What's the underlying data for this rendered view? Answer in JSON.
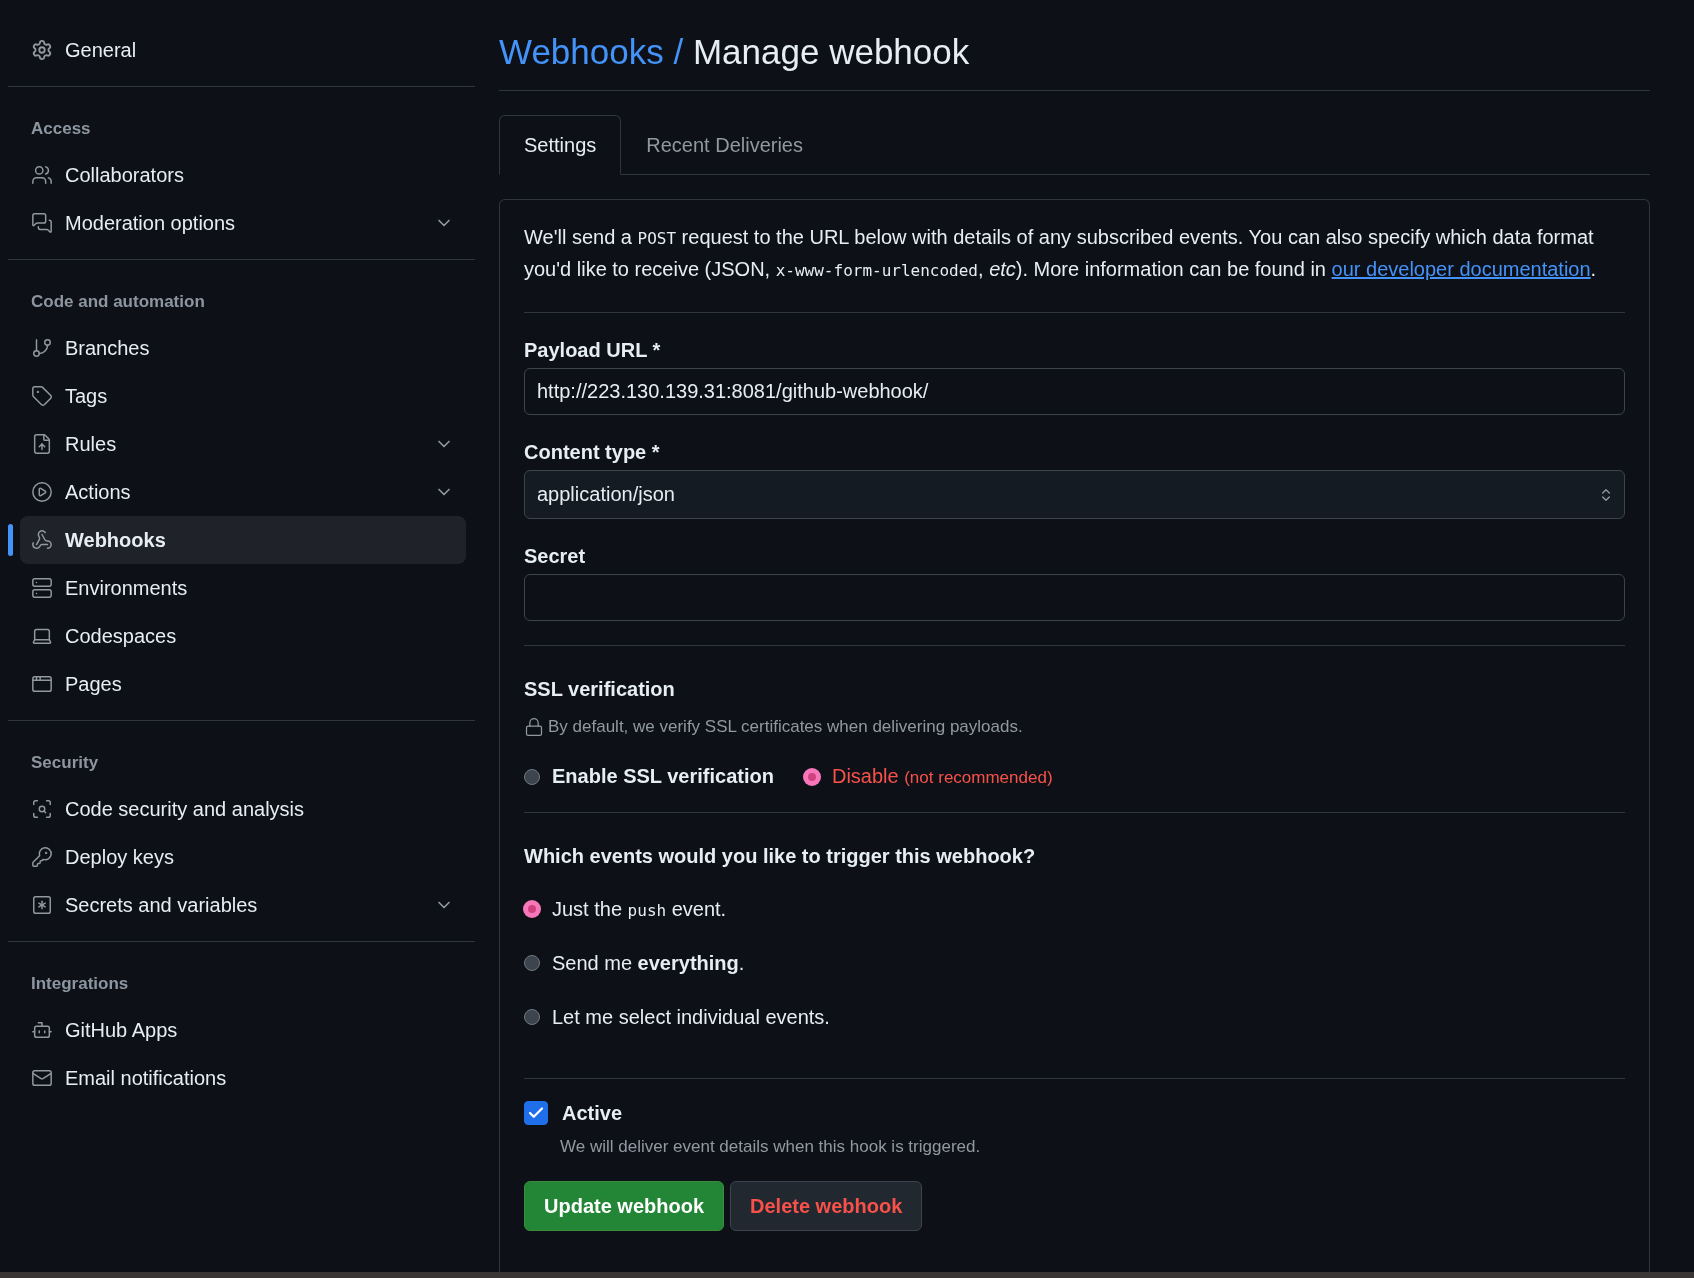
{
  "sidebar": {
    "top_item": {
      "label": "General",
      "selected": false
    },
    "groups": [
      {
        "heading": "Access",
        "items": [
          {
            "label": "Collaborators",
            "kind": "link",
            "selected": false
          },
          {
            "label": "Moderation options",
            "kind": "group",
            "selected": false
          }
        ]
      },
      {
        "heading": "Code and automation",
        "items": [
          {
            "label": "Branches",
            "kind": "link",
            "selected": false
          },
          {
            "label": "Tags",
            "kind": "link",
            "selected": false
          },
          {
            "label": "Rules",
            "kind": "group",
            "selected": false
          },
          {
            "label": "Actions",
            "kind": "group",
            "selected": false
          },
          {
            "label": "Webhooks",
            "kind": "link",
            "selected": true
          },
          {
            "label": "Environments",
            "kind": "link",
            "selected": false
          },
          {
            "label": "Codespaces",
            "kind": "link",
            "selected": false
          },
          {
            "label": "Pages",
            "kind": "link",
            "selected": false
          }
        ]
      },
      {
        "heading": "Security",
        "items": [
          {
            "label": "Code security and analysis",
            "kind": "link",
            "selected": false
          },
          {
            "label": "Deploy keys",
            "kind": "link",
            "selected": false
          },
          {
            "label": "Secrets and variables",
            "kind": "group",
            "selected": false
          }
        ]
      },
      {
        "heading": "Integrations",
        "items": [
          {
            "label": "GitHub Apps",
            "kind": "link",
            "selected": false
          },
          {
            "label": "Email notifications",
            "kind": "link",
            "selected": false
          }
        ]
      }
    ]
  },
  "breadcrumb": {
    "parent": "Webhooks",
    "separator": "/",
    "current": "Manage webhook"
  },
  "tabs": [
    {
      "label": "Settings",
      "selected": true
    },
    {
      "label": "Recent Deliveries",
      "selected": false
    }
  ],
  "description": [
    {
      "kind": "text",
      "text": "We'll send a "
    },
    {
      "kind": "code",
      "text": "POST"
    },
    {
      "kind": "text",
      "text": " request to the URL below with details of any subscribed events. You can also specify which data format you'd like to receive (JSON, "
    },
    {
      "kind": "code",
      "text": "x-www-form-urlencoded"
    },
    {
      "kind": "text",
      "text": ", "
    },
    {
      "kind": "em",
      "text": "etc"
    },
    {
      "kind": "text",
      "text": "). More information can be found in "
    },
    {
      "kind": "link",
      "text": "our developer documentation"
    },
    {
      "kind": "text",
      "text": "."
    }
  ],
  "fields": [
    {
      "label": "Payload URL *",
      "kind": "input",
      "value": "http://223.130.139.31:8081/github-webhook/"
    },
    {
      "label": "Content type *",
      "kind": "select",
      "value": "application/json"
    },
    {
      "label": "Secret",
      "kind": "input"
    }
  ],
  "ssl": {
    "heading": "SSL verification",
    "note": "By default, we verify SSL certificates when delivering payloads.",
    "options": [
      {
        "label": "Enable SSL verification",
        "kind": "normal",
        "selected": false
      },
      {
        "label": "Disable",
        "note": "(not recommended)",
        "kind": "danger",
        "selected": true
      }
    ]
  },
  "events": {
    "question": "Which events would you like to trigger this webhook?",
    "options": [
      {
        "parts": [
          {
            "kind": "text",
            "text": "Just the "
          },
          {
            "kind": "code",
            "text": "push"
          },
          {
            "kind": "text",
            "text": " event."
          }
        ],
        "selected": true
      },
      {
        "parts": [
          {
            "kind": "text",
            "text": "Send me "
          },
          {
            "kind": "strong",
            "text": "everything"
          },
          {
            "kind": "text",
            "text": "."
          }
        ],
        "selected": false
      },
      {
        "parts": [
          {
            "kind": "text",
            "text": "Let me select individual events."
          }
        ],
        "selected": false
      }
    ]
  },
  "active": {
    "label": "Active",
    "checked": true,
    "hint": "We will deliver event details when this hook is triggered."
  },
  "buttons": [
    {
      "label": "Update webhook",
      "kind": "primary"
    },
    {
      "label": "Delete webhook",
      "kind": "danger"
    }
  ]
}
